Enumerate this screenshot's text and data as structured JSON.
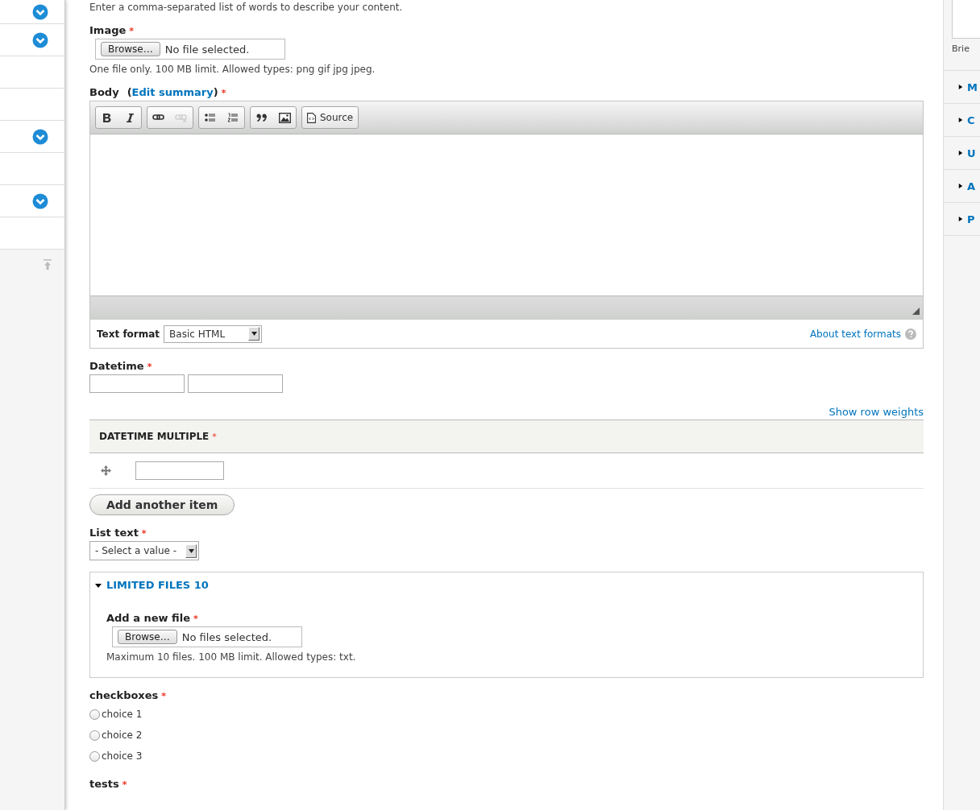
{
  "left_sidebar": {
    "items": [
      {
        "has_toggle": true
      },
      {
        "has_toggle": true
      },
      {
        "has_toggle": false
      },
      {
        "has_toggle": false
      },
      {
        "has_toggle": true
      },
      {
        "has_toggle": false
      },
      {
        "has_toggle": true
      },
      {
        "has_toggle": false
      }
    ]
  },
  "tags_help": "Enter a comma-separated list of words to describe your content.",
  "image": {
    "label": "Image",
    "required_mark": "*",
    "button": "Browse…",
    "status": "No file selected.",
    "help": "One file only. 100 MB limit. Allowed types: png gif jpg jpeg."
  },
  "body": {
    "label": "Body",
    "open_paren": "(",
    "link": "Edit summary",
    "close_paren": ")",
    "required_mark": "*",
    "toolbar_groups": [
      {
        "buttons": [
          {
            "kind": "bold",
            "disabled": false
          },
          {
            "kind": "italic",
            "disabled": false
          }
        ]
      },
      {
        "buttons": [
          {
            "kind": "link",
            "disabled": false
          },
          {
            "kind": "unlink",
            "disabled": true
          }
        ]
      },
      {
        "buttons": [
          {
            "kind": "bulleted-list",
            "disabled": false
          },
          {
            "kind": "numbered-list",
            "disabled": false
          }
        ]
      },
      {
        "buttons": [
          {
            "kind": "blockquote",
            "disabled": false
          },
          {
            "kind": "image",
            "disabled": false
          }
        ]
      },
      {
        "buttons": [
          {
            "kind": "source",
            "disabled": false,
            "label": "Source"
          }
        ]
      }
    ],
    "text_format_label": "Text format",
    "text_format_value": "Basic HTML",
    "about_link": "About text formats"
  },
  "datetime": {
    "label": "Datetime",
    "required_mark": "*"
  },
  "show_row_weights": "Show row weights",
  "datetime_multiple": {
    "header": "DATETIME MULTIPLE",
    "required_mark": "*",
    "button": "Add another item"
  },
  "list_text": {
    "label": "List text",
    "required_mark": "*",
    "value": "- Select a value -"
  },
  "limited_files": {
    "title": "LIMITED FILES 10",
    "expanded": true,
    "label": "Add a new file",
    "required_mark": "*",
    "button": "Browse…",
    "status": "No files selected.",
    "help": "Maximum 10 files. 100 MB limit. Allowed types: txt."
  },
  "checkboxes": {
    "label": "checkboxes",
    "required_mark": "*",
    "options": [
      {
        "label": "choice 1",
        "checked": false
      },
      {
        "label": "choice 2",
        "checked": false
      },
      {
        "label": "choice 3",
        "checked": false
      }
    ]
  },
  "tests": {
    "label": "tests",
    "required_mark": "*"
  },
  "right_sidebar": {
    "help": "Brie",
    "sections": [
      {
        "title": "M",
        "expanded": false
      },
      {
        "title": "C",
        "expanded": false
      },
      {
        "title": "U",
        "expanded": false
      },
      {
        "title": "A",
        "expanded": false
      },
      {
        "title": "P",
        "expanded": false
      }
    ]
  }
}
